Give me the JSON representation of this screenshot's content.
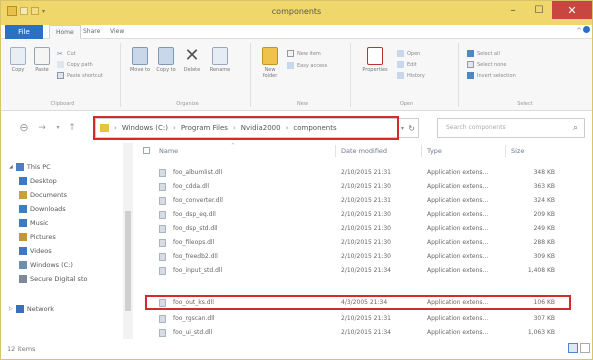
{
  "window": {
    "title": "components"
  },
  "ribbon": {
    "tabs": [
      "File",
      "Home",
      "Share",
      "View"
    ],
    "clipboard": {
      "copy": "Copy",
      "paste": "Paste",
      "cut": "Cut",
      "copy_path": "Copy path",
      "paste_shortcut": "Paste shortcut",
      "label": "Clipboard"
    },
    "organize": {
      "move_to": "Move to",
      "copy_to": "Copy to",
      "delete": "Delete",
      "rename": "Rename",
      "label": "Organize"
    },
    "new": {
      "new_folder": "New folder",
      "new_item": "New item",
      "easy_access": "Easy access",
      "label": "New"
    },
    "open": {
      "properties": "Properties",
      "open": "Open",
      "edit": "Edit",
      "history": "History",
      "label": "Open"
    },
    "select": {
      "select_all": "Select all",
      "select_none": "Select none",
      "invert_selection": "Invert selection",
      "label": "Select"
    }
  },
  "address": {
    "segments": [
      "Windows (C:)",
      "Program Files",
      "Nvidia2000",
      "components"
    ],
    "search_placeholder": "Search components"
  },
  "navigation": {
    "items": [
      {
        "label": "This PC",
        "icon": "computer-icon",
        "color": "#4a7fc1"
      },
      {
        "label": "Desktop",
        "icon": "desktop-icon",
        "color": "#3b7bbf"
      },
      {
        "label": "Documents",
        "icon": "documents-icon",
        "color": "#c9a13a"
      },
      {
        "label": "Downloads",
        "icon": "downloads-icon",
        "color": "#3a7ec6"
      },
      {
        "label": "Music",
        "icon": "music-icon",
        "color": "#3b79c4"
      },
      {
        "label": "Pictures",
        "icon": "pictures-icon",
        "color": "#c4953a"
      },
      {
        "label": "Videos",
        "icon": "videos-icon",
        "color": "#3b79c4"
      },
      {
        "label": "Windows (C:)",
        "icon": "drive-icon",
        "color": "#6c8fb0"
      },
      {
        "label": "Secure Digital sto",
        "icon": "sd-card-icon",
        "color": "#7a8a99"
      },
      {
        "label": "Network",
        "icon": "network-icon",
        "color": "#3b6fb6"
      }
    ]
  },
  "files": {
    "columns": {
      "name": "Name",
      "date": "Date modified",
      "type": "Type",
      "size": "Size"
    },
    "rows": [
      {
        "name": "foo_albumlist.dll",
        "date": "2/10/2015 21:31",
        "type": "Application extens...",
        "size": "348 KB"
      },
      {
        "name": "foo_cdda.dll",
        "date": "2/10/2015 21:30",
        "type": "Application extens...",
        "size": "363 KB"
      },
      {
        "name": "foo_converter.dll",
        "date": "2/10/2015 21:31",
        "type": "Application extens...",
        "size": "324 KB"
      },
      {
        "name": "foo_dsp_eq.dll",
        "date": "2/10/2015 21:30",
        "type": "Application extens...",
        "size": "209 KB"
      },
      {
        "name": "foo_dsp_std.dll",
        "date": "2/10/2015 21:30",
        "type": "Application extens...",
        "size": "249 KB"
      },
      {
        "name": "foo_fileops.dll",
        "date": "2/10/2015 21:30",
        "type": "Application extens...",
        "size": "288 KB"
      },
      {
        "name": "foo_freedb2.dll",
        "date": "2/10/2015 21:30",
        "type": "Application extens...",
        "size": "309 KB"
      },
      {
        "name": "foo_input_std.dll",
        "date": "2/10/2015 21:34",
        "type": "Application extens...",
        "size": "1,408 KB"
      },
      {
        "name": "foo_out_ks.dll",
        "date": "4/3/2005 21:34",
        "type": "Application extens...",
        "size": "106 KB"
      },
      {
        "name": "foo_rgscan.dll",
        "date": "2/10/2015 21:31",
        "type": "Application extens...",
        "size": "307 KB"
      },
      {
        "name": "foo_ui_std.dll",
        "date": "2/10/2015 21:34",
        "type": "Application extens...",
        "size": "1,063 KB"
      }
    ]
  },
  "status": {
    "item_count": "12 items"
  },
  "colors": {
    "title_bar": "#f0d76b",
    "file_tab": "#2a70c4",
    "close_button": "#c7463f",
    "highlight": "#d42a2a"
  }
}
